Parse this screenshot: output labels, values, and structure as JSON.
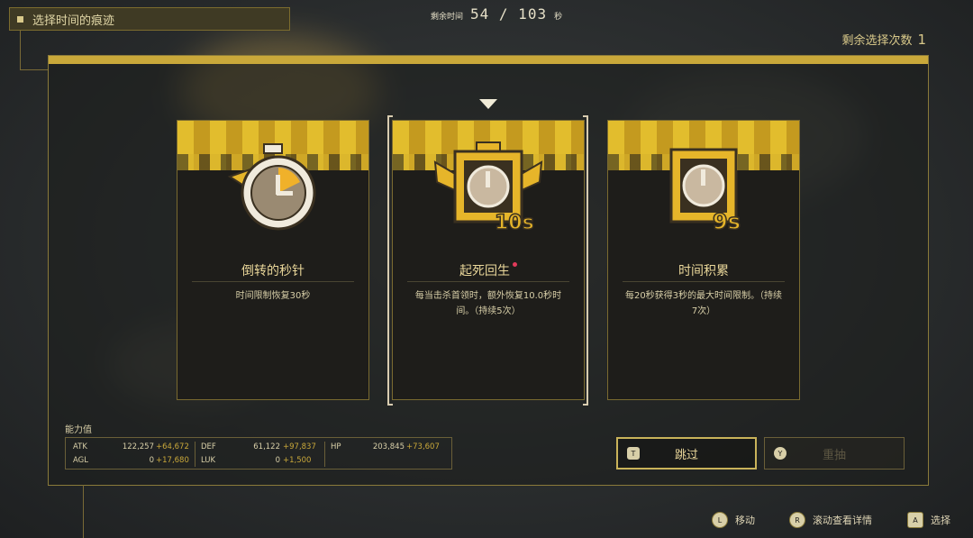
{
  "header": {
    "title": "选择时间的痕迹",
    "timer_label": "剩余时间",
    "timer_value": "54 / 103",
    "timer_unit": "秒",
    "remaining_label": "剩余选择次数",
    "remaining_value": "1"
  },
  "cards": [
    {
      "name": "倒转的秒针",
      "desc": "时间限制恢复30秒",
      "icon": "stopwatch-icon",
      "new": false,
      "selected": false
    },
    {
      "name": "起死回生",
      "desc": "每当击杀首领时，额外恢复10.0秒时间。（持续5次）",
      "icon": "winged-timer-10s-icon",
      "new": true,
      "selected": true
    },
    {
      "name": "时间积累",
      "desc": "每20秒获得3秒的最大时间限制。（持续7次）",
      "icon": "timer-9s-icon",
      "new": false,
      "selected": false
    }
  ],
  "stats": {
    "label": "能力值",
    "atk": {
      "k": "ATK",
      "v": "122,257",
      "p": "+64,672"
    },
    "agl": {
      "k": "AGL",
      "v": "0",
      "p": "+17,680"
    },
    "def": {
      "k": "DEF",
      "v": "61,122",
      "p": "+97,837"
    },
    "luk": {
      "k": "LUK",
      "v": "0",
      "p": "+1,500"
    },
    "hp": {
      "k": "HP",
      "v": "203,845",
      "p": "+73,607"
    }
  },
  "buttons": {
    "skip": {
      "label": "跳过",
      "key": "T"
    },
    "reroll": {
      "label": "重抽",
      "key": "Y"
    }
  },
  "hints": [
    {
      "key": "L",
      "label": "移动"
    },
    {
      "key": "R",
      "label": "滚动查看详情"
    },
    {
      "key": "A",
      "label": "选择"
    }
  ],
  "colors": {
    "accent": "#c9a83a",
    "banner": "#e2bd2d",
    "card_bg": "#1e1d1a",
    "new_dot": "#e23a5a"
  }
}
